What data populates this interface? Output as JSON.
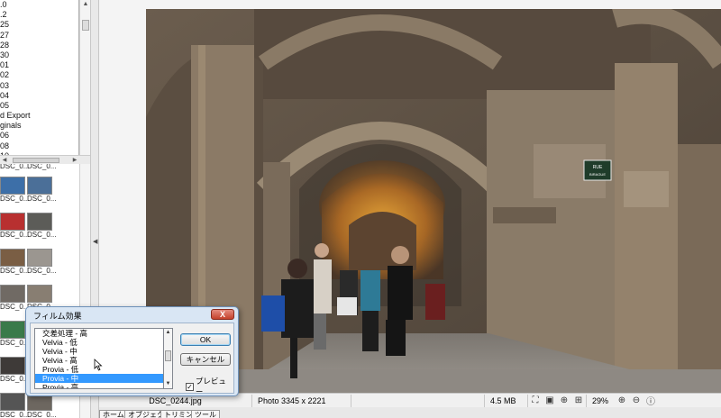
{
  "folders": {
    "items": [
      ".0",
      ".2",
      "25",
      "27",
      "28",
      "30",
      "01",
      "02",
      "03",
      "04",
      "05",
      "d Export",
      "ginals",
      "06",
      "08",
      "10"
    ]
  },
  "thumbnails": {
    "labels_top": [
      "DSC_0...",
      "DSC_0..."
    ],
    "items": [
      {
        "label": "DSC_0...",
        "color": "#3d6fa8"
      },
      {
        "label": "DSC_0...",
        "color": "#4b6f98"
      },
      {
        "label": "DSC_0...",
        "color": "#b83030"
      },
      {
        "label": "DSC_0...",
        "color": "#5c5c58"
      },
      {
        "label": "DSC_0...",
        "color": "#7a5e44"
      },
      {
        "label": "DSC_0...",
        "color": "#9b9690"
      },
      {
        "label": "DSC_0...",
        "color": "#706a64"
      },
      {
        "label": "DSC_0...",
        "color": "#887e72"
      },
      {
        "label": "DSC_0...",
        "color": "#3a7a4a"
      },
      {
        "label": "DSC_0...",
        "color": "#6c625a"
      },
      {
        "label": "DSC_0...",
        "color": "#3e3a38"
      },
      {
        "label": "DSC_0...",
        "color": "#a49a8c"
      },
      {
        "label": "DSC_0...",
        "color": "#555"
      },
      {
        "label": "DSC_0...",
        "color": "#6d6760"
      }
    ]
  },
  "status": {
    "filename": "DSC_0244.jpg",
    "dimensions": "Photo 3345 x 2221",
    "filesize": "4.5 MB",
    "zoom": "29%"
  },
  "tabs": [
    "ホーム",
    "オブジェクト",
    "トリミング",
    "ツール"
  ],
  "dialog": {
    "title": "フィルム効果",
    "close_label": "X",
    "effects": [
      "交差処理 - 高",
      "Velvia - 低",
      "Velvia - 中",
      "Velvia - 高",
      "Provia - 低",
      "Provia - 中",
      "Provia - 高"
    ],
    "selected_index": 5,
    "ok_label": "OK",
    "cancel_label": "キャンセル",
    "preview_label": "プレビュー",
    "preview_checked": true
  },
  "photo": {
    "sign_line1": "RUE",
    "sign_line2": "BIRAGUE"
  }
}
